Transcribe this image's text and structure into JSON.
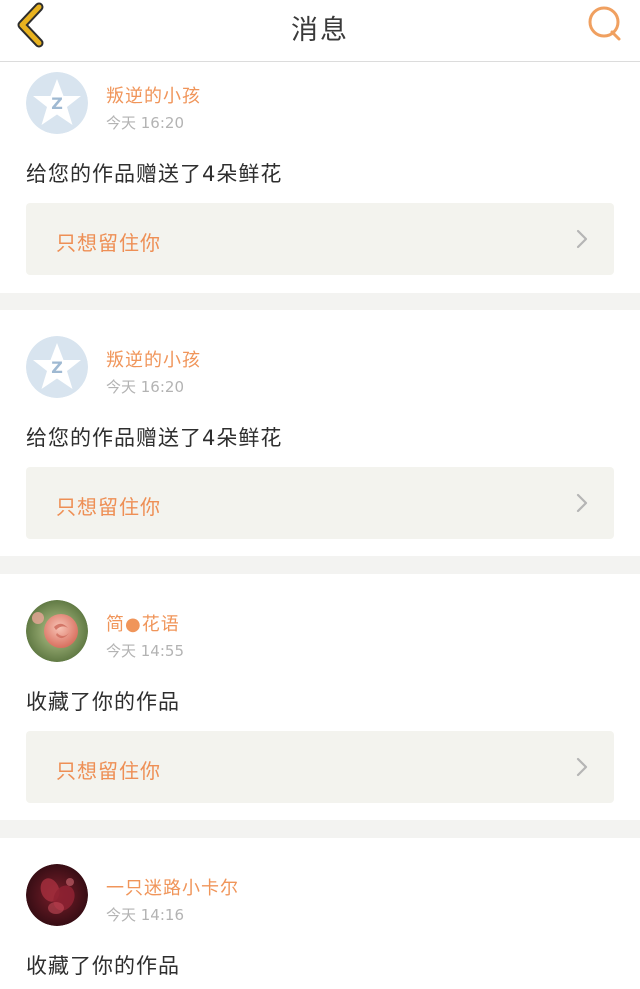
{
  "header": {
    "title": "消息"
  },
  "notifications": [
    {
      "username": "叛逆的小孩",
      "time": "今天 16:20",
      "message": "给您的作品赠送了4朵鲜花",
      "work_title": "只想留住你",
      "avatar": "qzone-star-avatar"
    },
    {
      "username": "叛逆的小孩",
      "time": "今天 16:20",
      "message": "给您的作品赠送了4朵鲜花",
      "work_title": "只想留住你",
      "avatar": "qzone-star-avatar"
    },
    {
      "username": "简●花语",
      "time": "今天 14:55",
      "message": "收藏了你的作品",
      "work_title": "只想留住你",
      "avatar": "pink-rose-photo"
    },
    {
      "username": "一只迷路小卡尔",
      "time": "今天 14:16",
      "message": "收藏了你的作品",
      "work_title": "",
      "avatar": "dark-red-flower-photo"
    }
  ],
  "colors": {
    "accent": "#f0955a",
    "back_icon": "#e8b21f",
    "search_icon": "#f0a060",
    "card_bg": "#ffffff",
    "link_bg": "#f3f3ee",
    "separator": "#f3f3f1"
  },
  "icons": {
    "back": "chevron-left-icon",
    "search": "search-icon",
    "link": "chevron-right-icon"
  }
}
